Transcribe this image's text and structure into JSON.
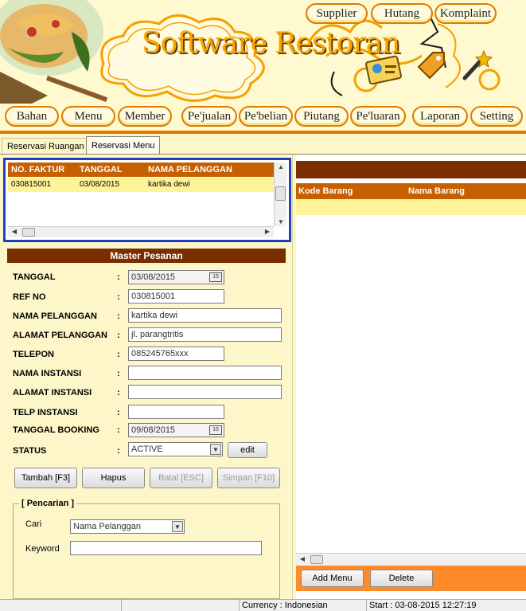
{
  "header": {
    "title": "Software Restoran",
    "top_buttons": [
      "Supplier",
      "Hutang",
      "Komplaint"
    ],
    "menu_buttons": [
      "Bahan",
      "Menu",
      "Member",
      "Pe'jualan",
      "Pe'belian",
      "Piutang",
      "Pe'luaran",
      "Laporan",
      "Setting"
    ]
  },
  "tabs": [
    {
      "label": "Reservasi Ruangan",
      "active": false
    },
    {
      "label": "Reservasi Menu",
      "active": true
    }
  ],
  "reservation_grid": {
    "columns": [
      "NO. FAKTUR",
      "TANGGAL",
      "NAMA PELANGGAN"
    ],
    "rows": [
      [
        "030815001",
        "03/08/2015",
        "kartika dewi"
      ]
    ]
  },
  "master": {
    "title": "Master Pesanan",
    "fields": [
      {
        "label": "TANGGAL",
        "value": "03/08/2015"
      },
      {
        "label": "REF NO",
        "value": "030815001"
      },
      {
        "label": "NAMA PELANGGAN",
        "value": "kartika dewi"
      },
      {
        "label": "ALAMAT PELANGGAN",
        "value": "jl. parangtritis"
      },
      {
        "label": "TELEPON",
        "value": "085245765xxx"
      },
      {
        "label": "NAMA INSTANSI",
        "value": ""
      },
      {
        "label": "ALAMAT INSTANSI",
        "value": ""
      },
      {
        "label": "TELP INSTANSI",
        "value": ""
      },
      {
        "label": "TANGGAL BOOKING",
        "value": "09/08/2015"
      },
      {
        "label": "STATUS",
        "value": "ACTIVE"
      }
    ],
    "colon": ":",
    "calendar_glyph": "15",
    "edit_label": "edit",
    "actions": {
      "add": "Tambah [F3]",
      "delete": "Hapus",
      "cancel": "Batal [ESC]",
      "save": "Simpan [F10]"
    }
  },
  "search": {
    "legend": "[ Pencarian ]",
    "cari_label": "Cari",
    "cari_value": "Nama Pelanggan",
    "keyword_label": "Keyword",
    "keyword_value": ""
  },
  "items_grid": {
    "columns": [
      "Kode Barang",
      "Nama Barang"
    ],
    "add_label": "Add Menu",
    "delete_label": "Delete"
  },
  "status_bar": {
    "currency": "Currency : Indonesian",
    "start": "Start : 03-08-2015 12:27:19"
  },
  "colors": {
    "accent": "#e07a00",
    "header_dark": "#7a2e00",
    "header_orange": "#c65f00",
    "row_highlight": "#fff39a",
    "selection_border": "#1f3fbf"
  }
}
